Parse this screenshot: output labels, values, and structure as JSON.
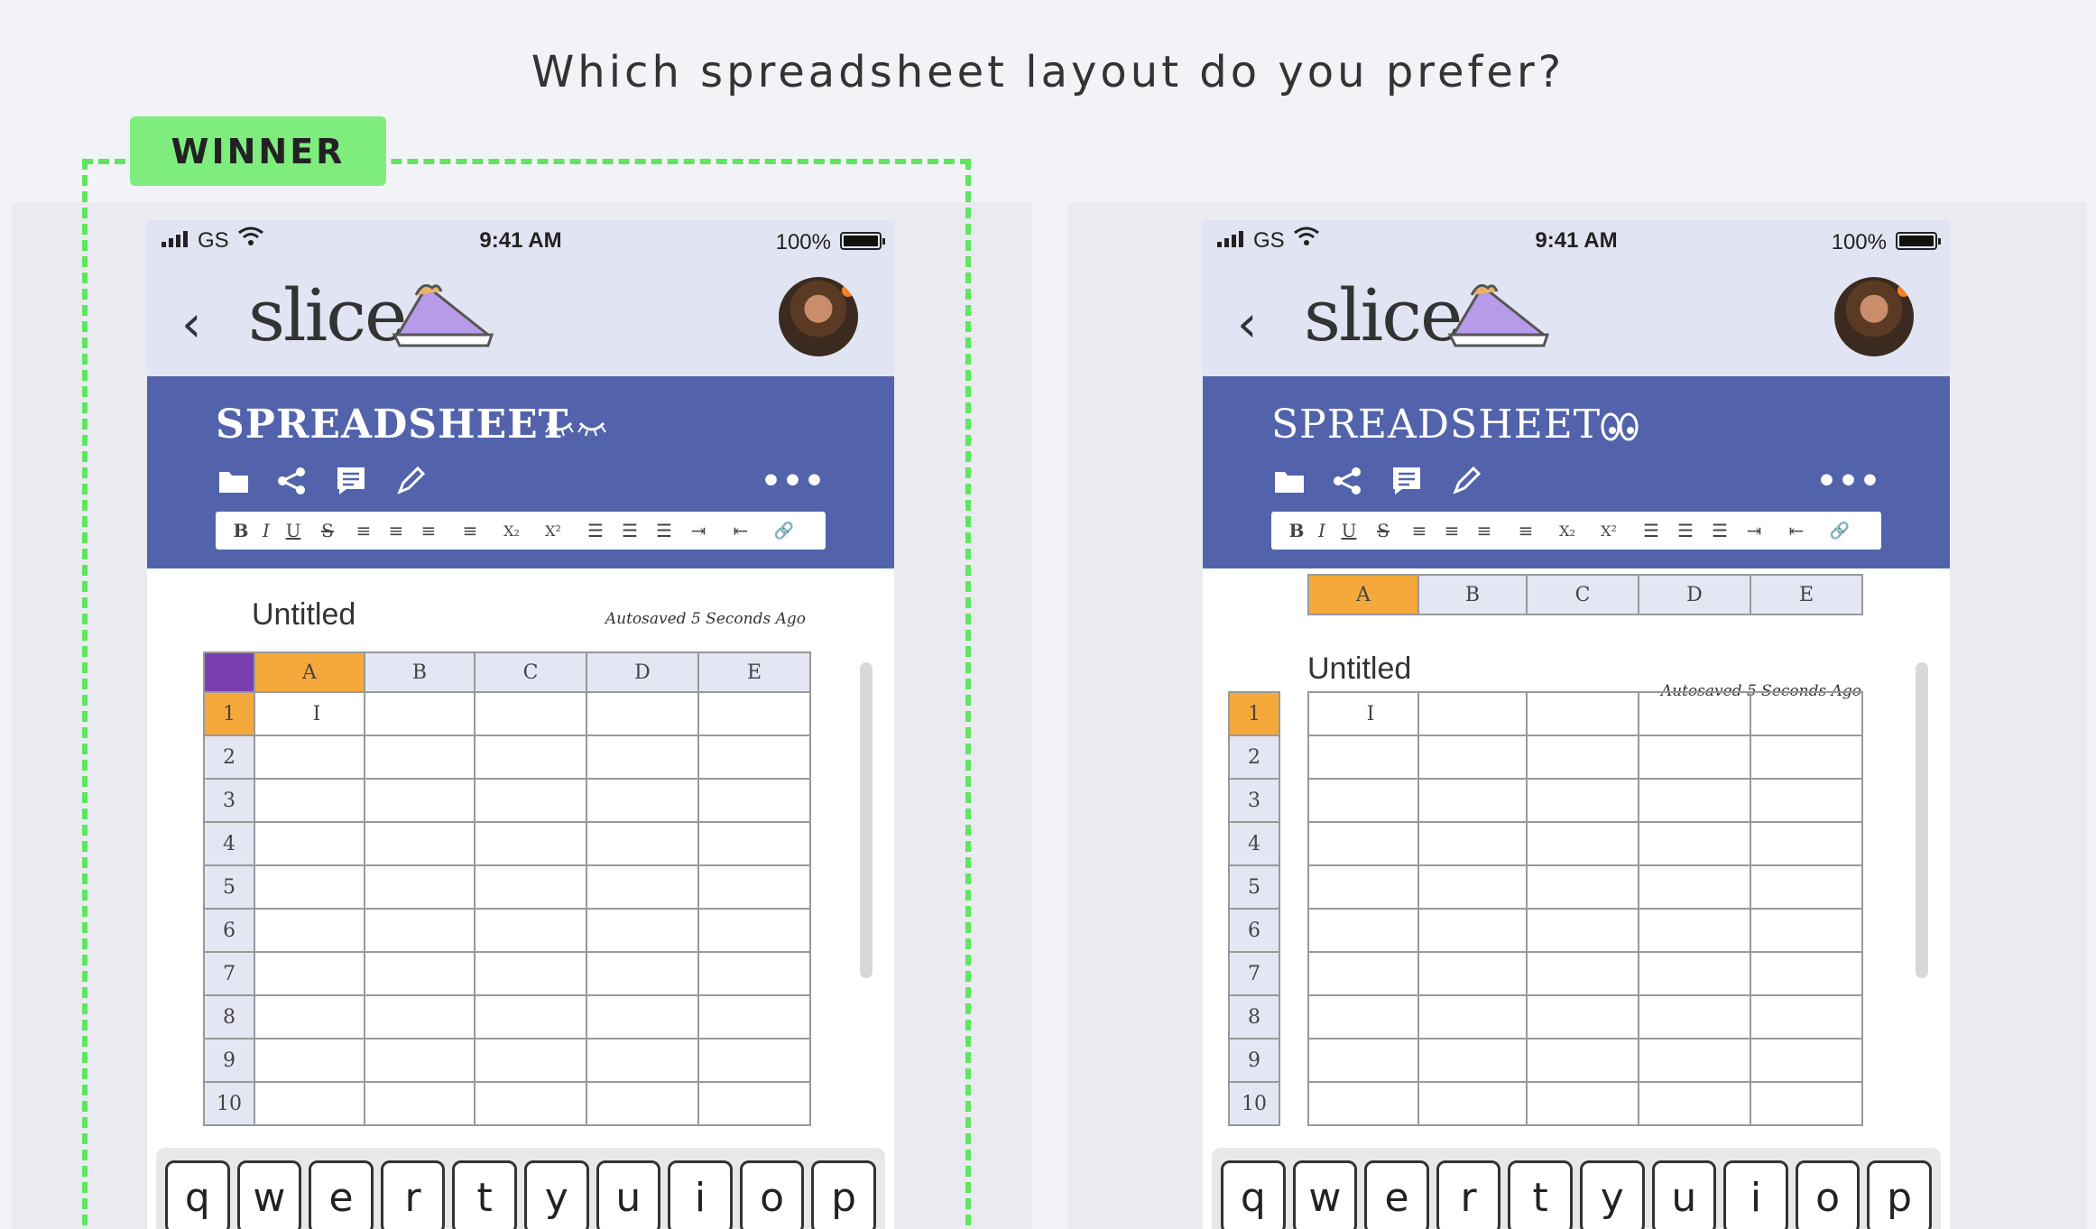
{
  "question": "Which spreadsheet layout do you prefer?",
  "winner_label": "WINNER",
  "colors": {
    "header_blue": "#5263ac",
    "selected_orange": "#f6a93b",
    "corner_purple": "#7b3fb0",
    "winner_green": "#5ee65e"
  },
  "variants": [
    {
      "status": {
        "carrier": "GS",
        "time": "9:41 AM",
        "battery": "100%"
      },
      "app": {
        "back": "‹",
        "logo": "slice",
        "avatar_icon": "user-avatar"
      },
      "header": {
        "doc_type": "SPREADSHEET",
        "eye_icon": "closed-eyes-icon",
        "eye_glyph": "ᵕᵕ",
        "more": "•••"
      },
      "toolbar": {
        "folder": "folder-icon",
        "share": "share-icon",
        "comment": "comment-icon",
        "edit": "pencil-icon"
      },
      "format": [
        "B",
        "I",
        "U",
        "S",
        "≡",
        "≡",
        "≡",
        "≡",
        "X₂",
        "X²",
        "☰",
        "☰",
        "☰",
        "⇥",
        "⇤",
        "🔗"
      ],
      "doc": {
        "title": "Untitled",
        "autosave": "Autosaved 5 Seconds Ago"
      },
      "columns": [
        "A",
        "B",
        "C",
        "D",
        "E"
      ],
      "rows": [
        "1",
        "2",
        "3",
        "4",
        "5",
        "6",
        "7",
        "8",
        "9",
        "10"
      ],
      "cursor": "I",
      "keys": [
        "q",
        "w",
        "e",
        "r",
        "t",
        "y",
        "u",
        "i",
        "o",
        "p"
      ]
    },
    {
      "status": {
        "carrier": "GS",
        "time": "9:41 AM",
        "battery": "100%"
      },
      "app": {
        "back": "‹",
        "logo": "slice",
        "avatar_icon": "user-avatar"
      },
      "header": {
        "doc_type": "SPREADSHEET",
        "eye_icon": "open-eyes-icon",
        "eye_glyph": "👀",
        "more": "•••"
      },
      "toolbar": {
        "folder": "folder-icon",
        "share": "share-icon",
        "comment": "comment-icon",
        "edit": "pencil-icon"
      },
      "format": [
        "B",
        "I",
        "U",
        "S",
        "≡",
        "≡",
        "≡",
        "≡",
        "X₂",
        "X²",
        "☰",
        "☰",
        "☰",
        "⇥",
        "⇤",
        "🔗"
      ],
      "doc": {
        "title": "Untitled",
        "autosave": "Autosaved 5 Seconds Ago"
      },
      "columns": [
        "A",
        "B",
        "C",
        "D",
        "E"
      ],
      "rows": [
        "1",
        "2",
        "3",
        "4",
        "5",
        "6",
        "7",
        "8",
        "9",
        "10"
      ],
      "cursor": "I",
      "keys": [
        "q",
        "w",
        "e",
        "r",
        "t",
        "y",
        "u",
        "i",
        "o",
        "p"
      ]
    }
  ]
}
